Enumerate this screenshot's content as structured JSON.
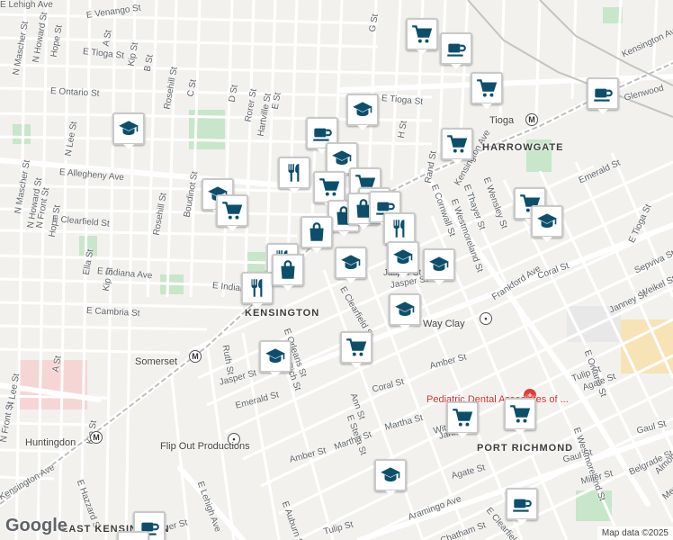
{
  "map": {
    "attribution": "Map data ©2025",
    "logo": "Google",
    "neighborhoods": [
      "KENSINGTON",
      "HARROWGATE",
      "PORT RICHMOND",
      "EAST KENSINGTON"
    ],
    "street_labels": [
      "E Venango St",
      "N Mascher St",
      "N Howard St",
      "Hope St",
      "A St",
      "Kip St",
      "B St",
      "E Tioga St",
      "E Ontario St",
      "Rosehill St",
      "C St",
      "D St",
      "Rorer St",
      "Hartville St",
      "E St",
      "N Lee St",
      "E Allegheny Ave",
      "N Front St",
      "N Mascher St",
      "N Howard St",
      "Hope St",
      "E Clearfield St",
      "Boudinot St",
      "Rosehill St",
      "Ella St",
      "Kip St",
      "E Indiana Ave",
      "E Indiana Ave",
      "E Cambria St",
      "E Tioga St",
      "G St",
      "H St",
      "Rand St",
      "Kensington Ave",
      "E Thayer St",
      "E Cornwall St",
      "E Westmoreland St",
      "E Wensley St",
      "Frankford Ave",
      "Jasper St",
      "Emerald St",
      "Coral St",
      "E Tioga St",
      "Sepviva St",
      "Weikel St",
      "Janney St",
      "E Ontario St",
      "Tulip St",
      "Agate St",
      "Kensington Ave",
      "Glenwood",
      "Ruth St",
      "Jasper St",
      "Emerald St",
      "E Orleans St",
      "Rich St",
      "Ann St",
      "E Stella St",
      "Coral St",
      "Amber St",
      "Martha St",
      "Witte St",
      "Janney St",
      "E Westmoreland St",
      "Gaul St",
      "Gaul St",
      "Miller St",
      "Belgrade St",
      "Almond St",
      "Mercer St",
      "Agate St",
      "Amber St",
      "E Auburn St",
      "Martha St",
      "Tulip St",
      "E Hazzard St",
      "E Lehigh Ave",
      "Aramingo Ave",
      "Chatham St",
      "E Clearfield St",
      "E Lehigh Ave",
      "N Lee St",
      "N Front St",
      "Kip St",
      "A St",
      "Amber St",
      "Kensington Ave",
      "E Clearfield St",
      "Jasper St"
    ],
    "places": [
      {
        "name": "Tioga",
        "type": "subway-station"
      },
      {
        "name": "Somerset",
        "type": "subway-station"
      },
      {
        "name": "Huntingdon",
        "type": "subway-station"
      },
      {
        "name": "Way Clay",
        "type": "store"
      },
      {
        "name": "Flip Out Productions",
        "type": "business"
      },
      {
        "name": "Pediatric Dental Associates of ...",
        "type": "dentist"
      }
    ],
    "pins": [
      {
        "type": "grocery"
      },
      {
        "type": "cafe"
      },
      {
        "type": "grocery"
      },
      {
        "type": "cafe"
      },
      {
        "type": "school"
      },
      {
        "type": "school"
      },
      {
        "type": "grocery"
      },
      {
        "type": "restaurant"
      },
      {
        "type": "cafe"
      },
      {
        "type": "school"
      },
      {
        "type": "grocery"
      },
      {
        "type": "grocery"
      },
      {
        "type": "school"
      },
      {
        "type": "grocery"
      },
      {
        "type": "grocery"
      },
      {
        "type": "shopping"
      },
      {
        "type": "shopping"
      },
      {
        "type": "cafe"
      },
      {
        "type": "restaurant"
      },
      {
        "type": "school"
      },
      {
        "type": "school"
      },
      {
        "type": "school"
      },
      {
        "type": "shopping"
      },
      {
        "type": "restaurant"
      },
      {
        "type": "restaurant"
      },
      {
        "type": "grocery"
      },
      {
        "type": "shopping"
      },
      {
        "type": "school"
      },
      {
        "type": "grocery"
      },
      {
        "type": "school"
      },
      {
        "type": "school"
      },
      {
        "type": "grocery"
      },
      {
        "type": "grocery"
      },
      {
        "type": "school"
      },
      {
        "type": "cafe"
      },
      {
        "type": "cafe"
      },
      {
        "type": "cafe"
      }
    ]
  }
}
